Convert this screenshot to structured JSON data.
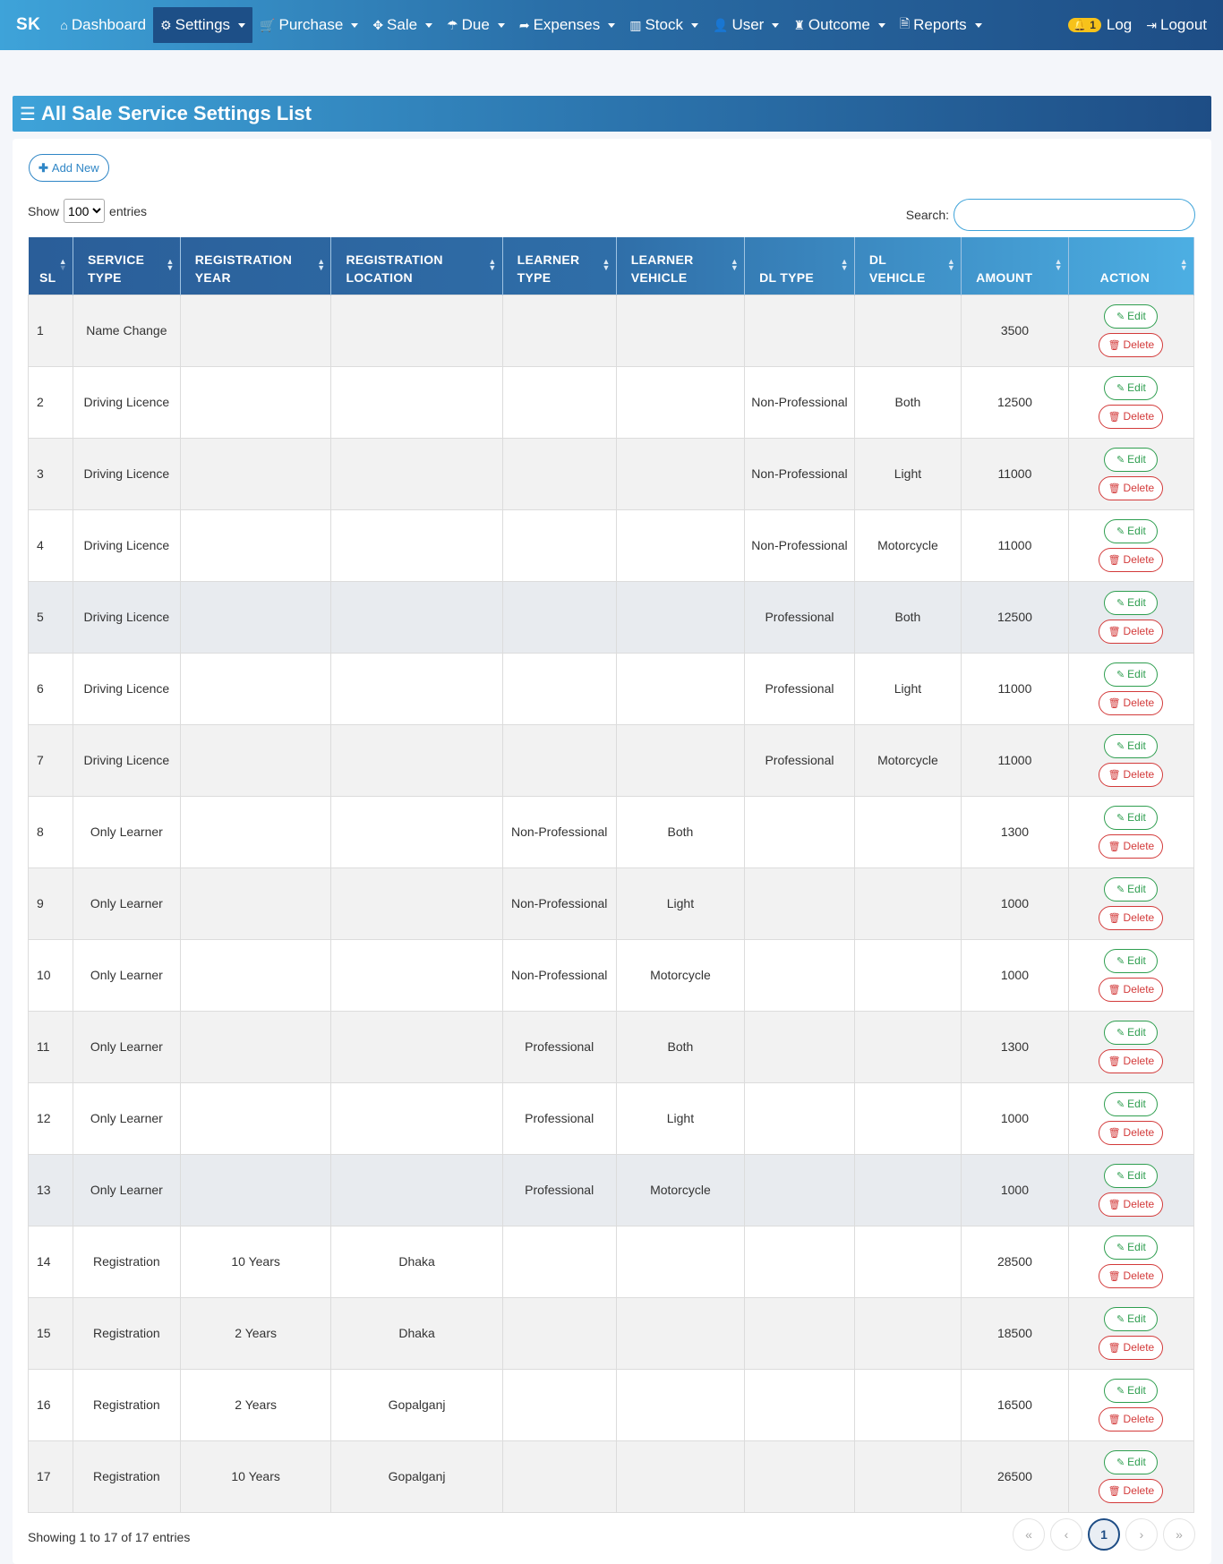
{
  "nav": {
    "brand": "SK",
    "items": [
      {
        "icon": "⌂",
        "label": "Dashboard",
        "dropdown": false,
        "active": false,
        "name": "dashboard"
      },
      {
        "icon": "⚙",
        "label": "Settings",
        "dropdown": true,
        "active": true,
        "name": "settings"
      },
      {
        "icon": "🛒",
        "label": "Purchase",
        "dropdown": true,
        "active": false,
        "name": "purchase"
      },
      {
        "icon": "✥",
        "label": "Sale",
        "dropdown": true,
        "active": false,
        "name": "sale"
      },
      {
        "icon": "☂",
        "label": "Due",
        "dropdown": true,
        "active": false,
        "name": "due"
      },
      {
        "icon": "➦",
        "label": "Expenses",
        "dropdown": true,
        "active": false,
        "name": "expenses"
      },
      {
        "icon": "▥",
        "label": "Stock",
        "dropdown": true,
        "active": false,
        "name": "stock"
      },
      {
        "icon": "👤",
        "label": "User",
        "dropdown": true,
        "active": false,
        "name": "user"
      },
      {
        "icon": "♜",
        "label": "Outcome",
        "dropdown": true,
        "active": false,
        "name": "outcome"
      },
      {
        "icon": "🗎",
        "label": "Reports",
        "dropdown": true,
        "active": false,
        "name": "reports"
      }
    ],
    "log_badge": "1",
    "log_label": "Log",
    "logout_label": "Logout"
  },
  "page": {
    "title": "All Sale Service Settings List",
    "add_new": "Add New",
    "show_label": "Show",
    "entries_label": "entries",
    "entries_value": "100",
    "search_label": "Search:",
    "search_value": "",
    "info": "Showing 1 to 17 of 17 entries",
    "current_page": "1"
  },
  "table": {
    "columns": [
      {
        "key": "sl",
        "line1": "SL",
        "line2": ""
      },
      {
        "key": "service_type",
        "line1": "SERVICE",
        "line2": "TYPE"
      },
      {
        "key": "reg_year",
        "line1": "REGISTRATION",
        "line2": "YEAR"
      },
      {
        "key": "reg_location",
        "line1": "REGISTRATION",
        "line2": "LOCATION"
      },
      {
        "key": "learner_type",
        "line1": "LEARNER",
        "line2": "TYPE"
      },
      {
        "key": "learner_vehicle",
        "line1": "LEARNER",
        "line2": "VEHICLE"
      },
      {
        "key": "dl_type",
        "line1": "DL TYPE",
        "line2": ""
      },
      {
        "key": "dl_vehicle",
        "line1": "DL",
        "line2": "VEHICLE"
      },
      {
        "key": "amount",
        "line1": "AMOUNT",
        "line2": ""
      },
      {
        "key": "action",
        "line1": "ACTION",
        "line2": ""
      }
    ],
    "edit_label": "Edit",
    "delete_label": "Delete",
    "rows": [
      {
        "sl": "1",
        "service_type": "Name Change",
        "reg_year": "",
        "reg_location": "",
        "learner_type": "",
        "learner_vehicle": "",
        "dl_type": "",
        "dl_vehicle": "",
        "amount": "3500"
      },
      {
        "sl": "2",
        "service_type": "Driving Licence",
        "reg_year": "",
        "reg_location": "",
        "learner_type": "",
        "learner_vehicle": "",
        "dl_type": "Non-Professional",
        "dl_vehicle": "Both",
        "amount": "12500"
      },
      {
        "sl": "3",
        "service_type": "Driving Licence",
        "reg_year": "",
        "reg_location": "",
        "learner_type": "",
        "learner_vehicle": "",
        "dl_type": "Non-Professional",
        "dl_vehicle": "Light",
        "amount": "11000"
      },
      {
        "sl": "4",
        "service_type": "Driving Licence",
        "reg_year": "",
        "reg_location": "",
        "learner_type": "",
        "learner_vehicle": "",
        "dl_type": "Non-Professional",
        "dl_vehicle": "Motorcycle",
        "amount": "11000"
      },
      {
        "sl": "5",
        "service_type": "Driving Licence",
        "reg_year": "",
        "reg_location": "",
        "learner_type": "",
        "learner_vehicle": "",
        "dl_type": "Professional",
        "dl_vehicle": "Both",
        "amount": "12500",
        "highlight": true
      },
      {
        "sl": "6",
        "service_type": "Driving Licence",
        "reg_year": "",
        "reg_location": "",
        "learner_type": "",
        "learner_vehicle": "",
        "dl_type": "Professional",
        "dl_vehicle": "Light",
        "amount": "11000"
      },
      {
        "sl": "7",
        "service_type": "Driving Licence",
        "reg_year": "",
        "reg_location": "",
        "learner_type": "",
        "learner_vehicle": "",
        "dl_type": "Professional",
        "dl_vehicle": "Motorcycle",
        "amount": "11000"
      },
      {
        "sl": "8",
        "service_type": "Only Learner",
        "reg_year": "",
        "reg_location": "",
        "learner_type": "Non-Professional",
        "learner_vehicle": "Both",
        "dl_type": "",
        "dl_vehicle": "",
        "amount": "1300"
      },
      {
        "sl": "9",
        "service_type": "Only Learner",
        "reg_year": "",
        "reg_location": "",
        "learner_type": "Non-Professional",
        "learner_vehicle": "Light",
        "dl_type": "",
        "dl_vehicle": "",
        "amount": "1000"
      },
      {
        "sl": "10",
        "service_type": "Only Learner",
        "reg_year": "",
        "reg_location": "",
        "learner_type": "Non-Professional",
        "learner_vehicle": "Motorcycle",
        "dl_type": "",
        "dl_vehicle": "",
        "amount": "1000"
      },
      {
        "sl": "11",
        "service_type": "Only Learner",
        "reg_year": "",
        "reg_location": "",
        "learner_type": "Professional",
        "learner_vehicle": "Both",
        "dl_type": "",
        "dl_vehicle": "",
        "amount": "1300"
      },
      {
        "sl": "12",
        "service_type": "Only Learner",
        "reg_year": "",
        "reg_location": "",
        "learner_type": "Professional",
        "learner_vehicle": "Light",
        "dl_type": "",
        "dl_vehicle": "",
        "amount": "1000"
      },
      {
        "sl": "13",
        "service_type": "Only Learner",
        "reg_year": "",
        "reg_location": "",
        "learner_type": "Professional",
        "learner_vehicle": "Motorcycle",
        "dl_type": "",
        "dl_vehicle": "",
        "amount": "1000",
        "highlight": true
      },
      {
        "sl": "14",
        "service_type": "Registration",
        "reg_year": "10 Years",
        "reg_location": "Dhaka",
        "learner_type": "",
        "learner_vehicle": "",
        "dl_type": "",
        "dl_vehicle": "",
        "amount": "28500"
      },
      {
        "sl": "15",
        "service_type": "Registration",
        "reg_year": "2 Years",
        "reg_location": "Dhaka",
        "learner_type": "",
        "learner_vehicle": "",
        "dl_type": "",
        "dl_vehicle": "",
        "amount": "18500"
      },
      {
        "sl": "16",
        "service_type": "Registration",
        "reg_year": "2 Years",
        "reg_location": "Gopalganj",
        "learner_type": "",
        "learner_vehicle": "",
        "dl_type": "",
        "dl_vehicle": "",
        "amount": "16500"
      },
      {
        "sl": "17",
        "service_type": "Registration",
        "reg_year": "10 Years",
        "reg_location": "Gopalganj",
        "learner_type": "",
        "learner_vehicle": "",
        "dl_type": "",
        "dl_vehicle": "",
        "amount": "26500"
      }
    ]
  },
  "pager": {
    "first": "«",
    "prev": "‹",
    "next": "›",
    "last": "»"
  }
}
